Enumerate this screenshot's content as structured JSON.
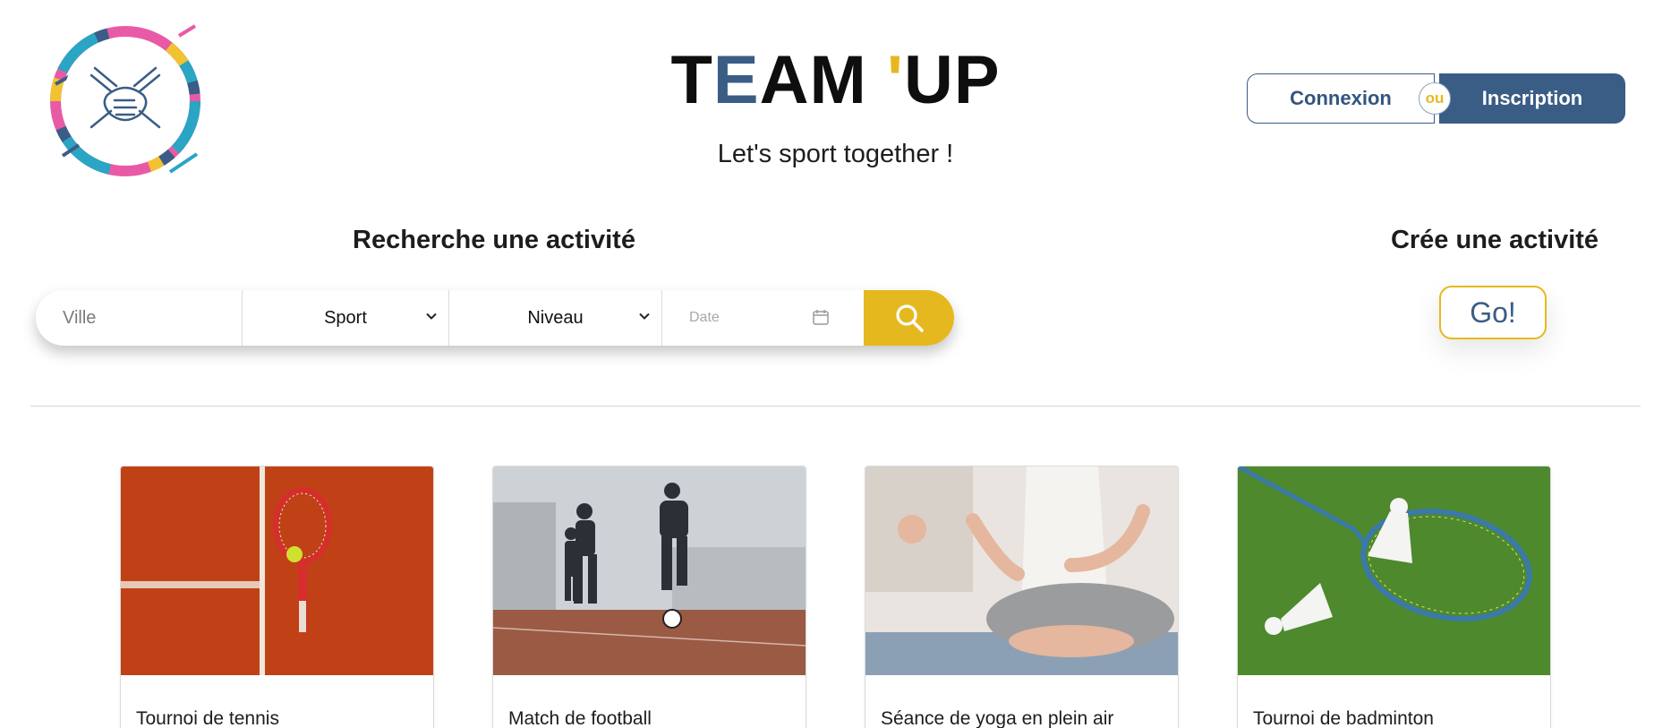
{
  "brand": {
    "title_parts": [
      "T",
      "E",
      "AM ",
      "'",
      "UP"
    ],
    "tagline": "Let's sport together !",
    "logo_icon": "joined-hands-logo"
  },
  "auth": {
    "login_label": "Connexion",
    "or_label": "ou",
    "signup_label": "Inscription"
  },
  "search": {
    "heading": "Recherche une activité",
    "city_placeholder": "Ville",
    "sport_label": "Sport",
    "level_label": "Niveau",
    "date_placeholder": "Date",
    "submit_icon": "search-icon"
  },
  "create": {
    "heading": "Crée une activité",
    "go_label": "Go!"
  },
  "activities": [
    {
      "title": "Tournoi de tennis",
      "image": "tennis-racket-on-clay-court"
    },
    {
      "title": "Match de football",
      "image": "men-playing-football"
    },
    {
      "title": "Séance de yoga en plein air",
      "image": "yoga-meditation-pose"
    },
    {
      "title": "Tournoi de badminton",
      "image": "badminton-racket-and-shuttlecocks"
    }
  ],
  "colors": {
    "brand_blue": "#3a5d85",
    "accent_yellow": "#e6b820",
    "text": "#1d1d1d"
  }
}
